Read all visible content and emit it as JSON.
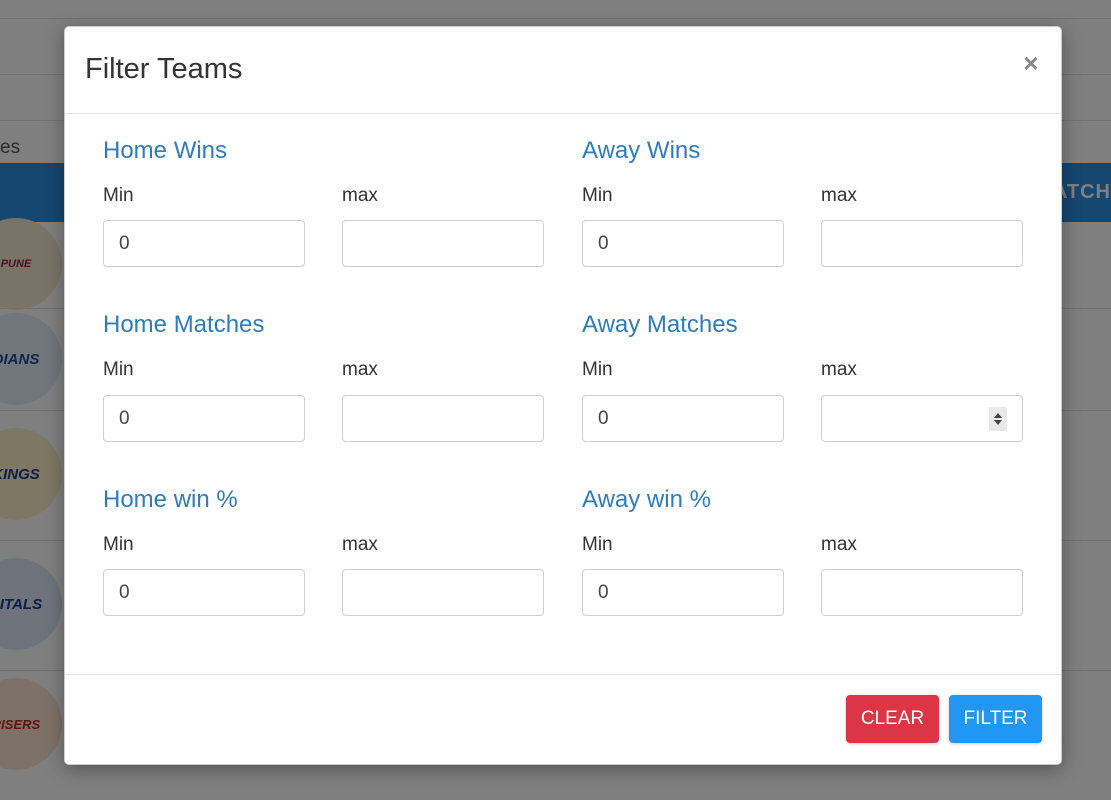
{
  "background": {
    "partial_text": "es",
    "header_partial_text": "ATCH",
    "logos": [
      {
        "name": "rising-pune-supergiant-logo",
        "text": "PUNE"
      },
      {
        "name": "mumbai-indians-logo",
        "text": "DIANS"
      },
      {
        "name": "chennai-super-kings-logo",
        "text": "KINGS"
      },
      {
        "name": "delhi-capitals-logo",
        "text": "PITALS"
      },
      {
        "name": "sunrisers-hyderabad-logo",
        "text": "RISERS"
      }
    ]
  },
  "modal": {
    "title": "Filter Teams",
    "close_symbol": "×",
    "groups": [
      {
        "title": "Home Wins",
        "min_label": "Min",
        "max_label": "max",
        "min_value": "0",
        "max_value": ""
      },
      {
        "title": "Away Wins",
        "min_label": "Min",
        "max_label": "max",
        "min_value": "0",
        "max_value": ""
      },
      {
        "title": "Home Matches",
        "min_label": "Min",
        "max_label": "max",
        "min_value": "0",
        "max_value": ""
      },
      {
        "title": "Away Matches",
        "min_label": "Min",
        "max_label": "max",
        "min_value": "0",
        "max_value": ""
      },
      {
        "title": "Home win %",
        "min_label": "Min",
        "max_label": "max",
        "min_value": "0",
        "max_value": ""
      },
      {
        "title": "Away win %",
        "min_label": "Min",
        "max_label": "max",
        "min_value": "0",
        "max_value": ""
      }
    ],
    "buttons": {
      "clear": "CLEAR",
      "filter": "FILTER"
    }
  },
  "colors": {
    "group_title": "#2e7cc0",
    "clear_button": "#dc3545",
    "filter_button": "#2196f3",
    "background_header": "#2b8ee0"
  }
}
